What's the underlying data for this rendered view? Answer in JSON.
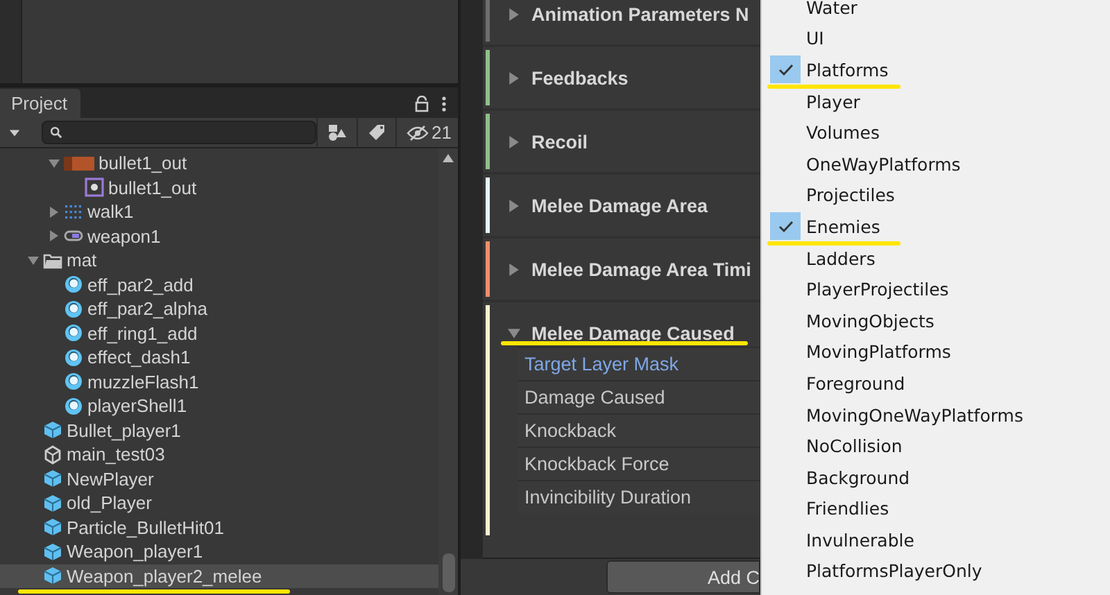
{
  "project_panel": {
    "tab": {
      "label": "Project",
      "selected": true
    },
    "hidden_count": "21",
    "tree": {
      "scrolled_parent_items": [
        {
          "label": "bullet1_out",
          "kind": "texture",
          "expanded": true,
          "selected": false,
          "underlined": false,
          "children": [
            {
              "label": "bullet1_out",
              "kind": "sprite",
              "selected": false,
              "underlined": false
            }
          ]
        },
        {
          "label": "walk1",
          "kind": "spritesheet",
          "expanded": false,
          "selected": false,
          "underlined": false
        },
        {
          "label": "weapon1",
          "kind": "animation",
          "expanded": false,
          "selected": false,
          "underlined": false
        }
      ],
      "items": [
        {
          "label": "mat",
          "kind": "folder",
          "expanded": true,
          "selected": false,
          "underlined": false,
          "children": [
            {
              "label": "eff_par2_add",
              "kind": "material",
              "selected": false,
              "underlined": false
            },
            {
              "label": "eff_par2_alpha",
              "kind": "material",
              "selected": false,
              "underlined": false
            },
            {
              "label": "eff_ring1_add",
              "kind": "material",
              "selected": false,
              "underlined": false
            },
            {
              "label": "effect_dash1",
              "kind": "material",
              "selected": false,
              "underlined": false
            },
            {
              "label": "muzzleFlash1",
              "kind": "material",
              "selected": false,
              "underlined": false
            },
            {
              "label": "playerShell1",
              "kind": "material",
              "selected": false,
              "underlined": false
            }
          ]
        },
        {
          "label": "Bullet_player1",
          "kind": "prefab",
          "selected": false,
          "underlined": false
        },
        {
          "label": "main_test03",
          "kind": "scene",
          "selected": false,
          "underlined": false
        },
        {
          "label": "NewPlayer",
          "kind": "prefab",
          "selected": false,
          "underlined": false
        },
        {
          "label": "old_Player",
          "kind": "prefab",
          "selected": false,
          "underlined": false
        },
        {
          "label": "Particle_BulletHit01",
          "kind": "prefab",
          "selected": false,
          "underlined": false
        },
        {
          "label": "Weapon_player1",
          "kind": "prefab",
          "selected": false,
          "underlined": false
        },
        {
          "label": "Weapon_player2_melee",
          "kind": "prefab",
          "selected": true,
          "underlined": true
        }
      ]
    }
  },
  "inspector": {
    "sections": [
      {
        "title": "Animation Parameters N",
        "expanded": false,
        "color": "#6e6e6e",
        "underlined": false
      },
      {
        "title": "Feedbacks",
        "expanded": false,
        "color": "#8fbf8a",
        "underlined": false
      },
      {
        "title": "Recoil",
        "expanded": false,
        "color": "#8fbf8a",
        "underlined": false
      },
      {
        "title": "Melee Damage Area",
        "expanded": false,
        "color": "#e4f6f6",
        "underlined": false
      },
      {
        "title": "Melee Damage Area Timi",
        "expanded": false,
        "color": "#ef8f6c",
        "underlined": false
      },
      {
        "title": "Melee Damage Caused",
        "expanded": true,
        "color": "#f7f3cf",
        "underlined": true,
        "fields": [
          {
            "label": "Target Layer Mask",
            "selected": true
          },
          {
            "label": "Damage Caused",
            "selected": false
          },
          {
            "label": "Knockback",
            "selected": false
          },
          {
            "label": "Knockback Force",
            "selected": false
          },
          {
            "label": "Invincibility Duration",
            "selected": false
          }
        ]
      }
    ],
    "add_button": "Add C"
  },
  "layer_menu": {
    "items": [
      {
        "label": "Water",
        "checked": false,
        "underlined": false
      },
      {
        "label": "UI",
        "checked": false,
        "underlined": false
      },
      {
        "label": "Platforms",
        "checked": true,
        "underlined": true
      },
      {
        "label": "Player",
        "checked": false,
        "underlined": false
      },
      {
        "label": "Volumes",
        "checked": false,
        "underlined": false
      },
      {
        "label": "OneWayPlatforms",
        "checked": false,
        "underlined": false
      },
      {
        "label": "Projectiles",
        "checked": false,
        "underlined": false
      },
      {
        "label": "Enemies",
        "checked": true,
        "underlined": true
      },
      {
        "label": "Ladders",
        "checked": false,
        "underlined": false
      },
      {
        "label": "PlayerProjectiles",
        "checked": false,
        "underlined": false
      },
      {
        "label": "MovingObjects",
        "checked": false,
        "underlined": false
      },
      {
        "label": "MovingPlatforms",
        "checked": false,
        "underlined": false
      },
      {
        "label": "Foreground",
        "checked": false,
        "underlined": false
      },
      {
        "label": "MovingOneWayPlatforms",
        "checked": false,
        "underlined": false
      },
      {
        "label": "NoCollision",
        "checked": false,
        "underlined": false
      },
      {
        "label": "Background",
        "checked": false,
        "underlined": false
      },
      {
        "label": "Friendlies",
        "checked": false,
        "underlined": false
      },
      {
        "label": "Invulnerable",
        "checked": false,
        "underlined": false
      },
      {
        "label": "PlatformsPlayerOnly",
        "checked": false,
        "underlined": false
      }
    ]
  }
}
